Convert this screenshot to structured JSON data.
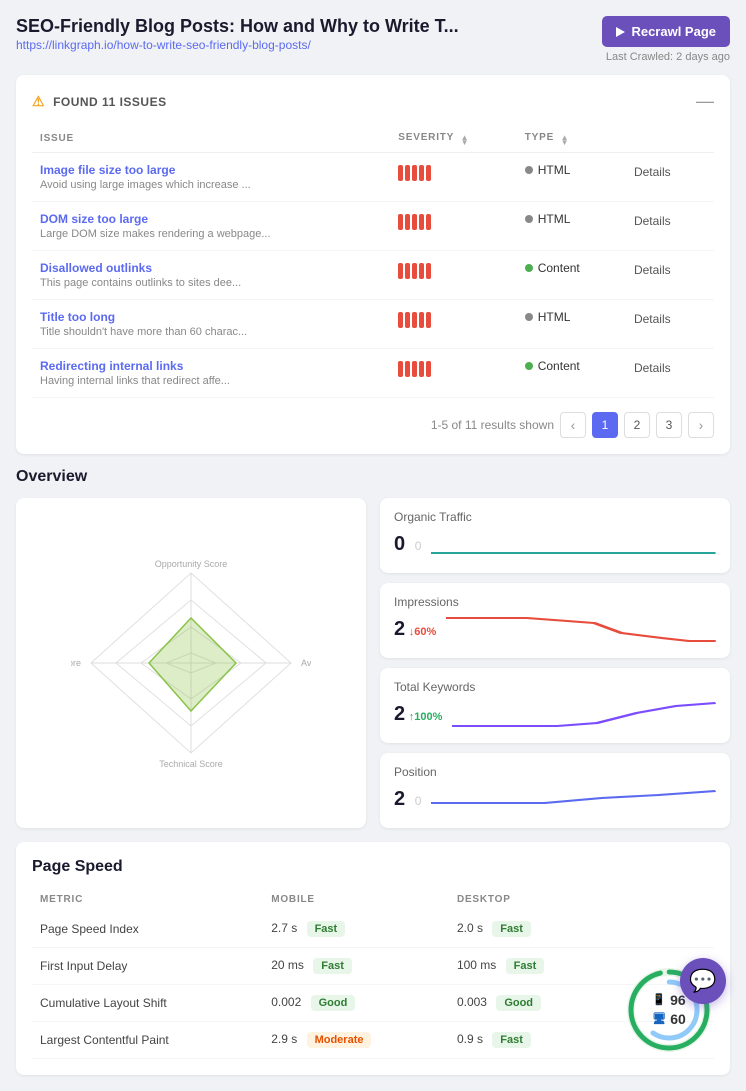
{
  "header": {
    "title": "SEO-Friendly Blog Posts: How and Why to Write T...",
    "url": "https://linkgraph.io/how-to-write-seo-friendly-blog-posts/",
    "recrawl_btn": "Recrawl Page",
    "last_crawled": "Last Crawled: 2 days ago"
  },
  "issues": {
    "header": "FOUND 11 ISSUES",
    "columns": [
      "ISSUE",
      "SEVERITY",
      "TYPE"
    ],
    "rows": [
      {
        "name": "Image file size too large",
        "desc": "Avoid using large images which increase ...",
        "severity": 5,
        "type": "HTML",
        "dot": "html",
        "details": "Details"
      },
      {
        "name": "DOM size too large",
        "desc": "Large DOM size makes rendering a webpage...",
        "severity": 5,
        "type": "HTML",
        "dot": "html",
        "details": "Details"
      },
      {
        "name": "Disallowed outlinks",
        "desc": "This page contains outlinks to sites dee...",
        "severity": 5,
        "type": "Content",
        "dot": "content",
        "details": "Details"
      },
      {
        "name": "Title too long",
        "desc": "Title shouldn't have more than 60 charac...",
        "severity": 5,
        "type": "HTML",
        "dot": "html",
        "details": "Details"
      },
      {
        "name": "Redirecting internal links",
        "desc": "Having internal links that redirect affe...",
        "severity": 5,
        "type": "Content",
        "dot": "content",
        "details": "Details"
      }
    ],
    "pagination": {
      "summary": "1-5 of 11 results shown",
      "pages": [
        "1",
        "2",
        "3"
      ]
    }
  },
  "overview": {
    "title": "Overview",
    "radar": {
      "labels": {
        "top": "Opportunity Score",
        "right": "Avg. Speed Index",
        "bottom": "Technical Score",
        "left": "Content Score"
      }
    },
    "stats": [
      {
        "id": "organic-traffic",
        "label": "Organic Traffic",
        "value": "0",
        "compare": "0",
        "change": null,
        "chart_color": "#26a69a"
      },
      {
        "id": "impressions",
        "label": "Impressions",
        "value": "2",
        "compare": null,
        "change": "↓60%",
        "change_dir": "down",
        "chart_color": "#e74c3c"
      },
      {
        "id": "total-keywords",
        "label": "Total Keywords",
        "value": "2",
        "compare": null,
        "change": "↑100%",
        "change_dir": "up",
        "chart_color": "#7c4dff"
      },
      {
        "id": "position",
        "label": "Position",
        "value": "2",
        "compare": "0",
        "change": null,
        "chart_color": "#5b6af0"
      }
    ]
  },
  "page_speed": {
    "title": "Page Speed",
    "columns": [
      "METRIC",
      "MOBILE",
      "DESKTOP"
    ],
    "rows": [
      {
        "metric": "Page Speed Index",
        "mobile_val": "2.7 s",
        "mobile_badge": "Fast",
        "mobile_badge_type": "fast",
        "desktop_val": "2.0 s",
        "desktop_badge": "Fast",
        "desktop_badge_type": "fast"
      },
      {
        "metric": "First Input Delay",
        "mobile_val": "20 ms",
        "mobile_badge": "Fast",
        "mobile_badge_type": "fast",
        "desktop_val": "100 ms",
        "desktop_badge": "Fast",
        "desktop_badge_type": "fast"
      },
      {
        "metric": "Cumulative Layout Shift",
        "mobile_val": "0.002",
        "mobile_badge": "Good",
        "mobile_badge_type": "good",
        "desktop_val": "0.003",
        "desktop_badge": "Good",
        "desktop_badge_type": "good"
      },
      {
        "metric": "Largest Contentful Paint",
        "mobile_val": "2.9 s",
        "mobile_badge": "Moderate",
        "mobile_badge_type": "moderate",
        "desktop_val": "0.9 s",
        "desktop_badge": "Fast",
        "desktop_badge_type": "fast"
      }
    ],
    "scores": {
      "mobile": "96",
      "desktop": "60"
    }
  },
  "chat_btn": "💬"
}
